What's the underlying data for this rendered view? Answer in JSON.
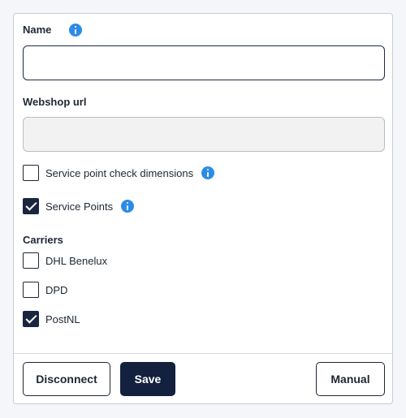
{
  "form": {
    "name": {
      "label": "Name",
      "value": "",
      "info_icon": "info-icon"
    },
    "webshop_url": {
      "label": "Webshop url",
      "value": ""
    },
    "service_point_check_dimensions": {
      "label": "Service point check dimensions",
      "checked": false,
      "info_icon": "info-icon"
    },
    "service_points": {
      "label": "Service Points",
      "checked": true,
      "info_icon": "info-icon"
    },
    "carriers": {
      "label": "Carriers",
      "items": [
        {
          "label": "DHL Benelux",
          "checked": false
        },
        {
          "label": "DPD",
          "checked": false
        },
        {
          "label": "PostNL",
          "checked": true
        }
      ]
    }
  },
  "footer": {
    "disconnect_label": "Disconnect",
    "save_label": "Save",
    "manual_label": "Manual"
  },
  "colors": {
    "primary": "#13213f",
    "info": "#2b8ce8",
    "border": "#c7cdd6",
    "background": "#f4f6fa"
  }
}
